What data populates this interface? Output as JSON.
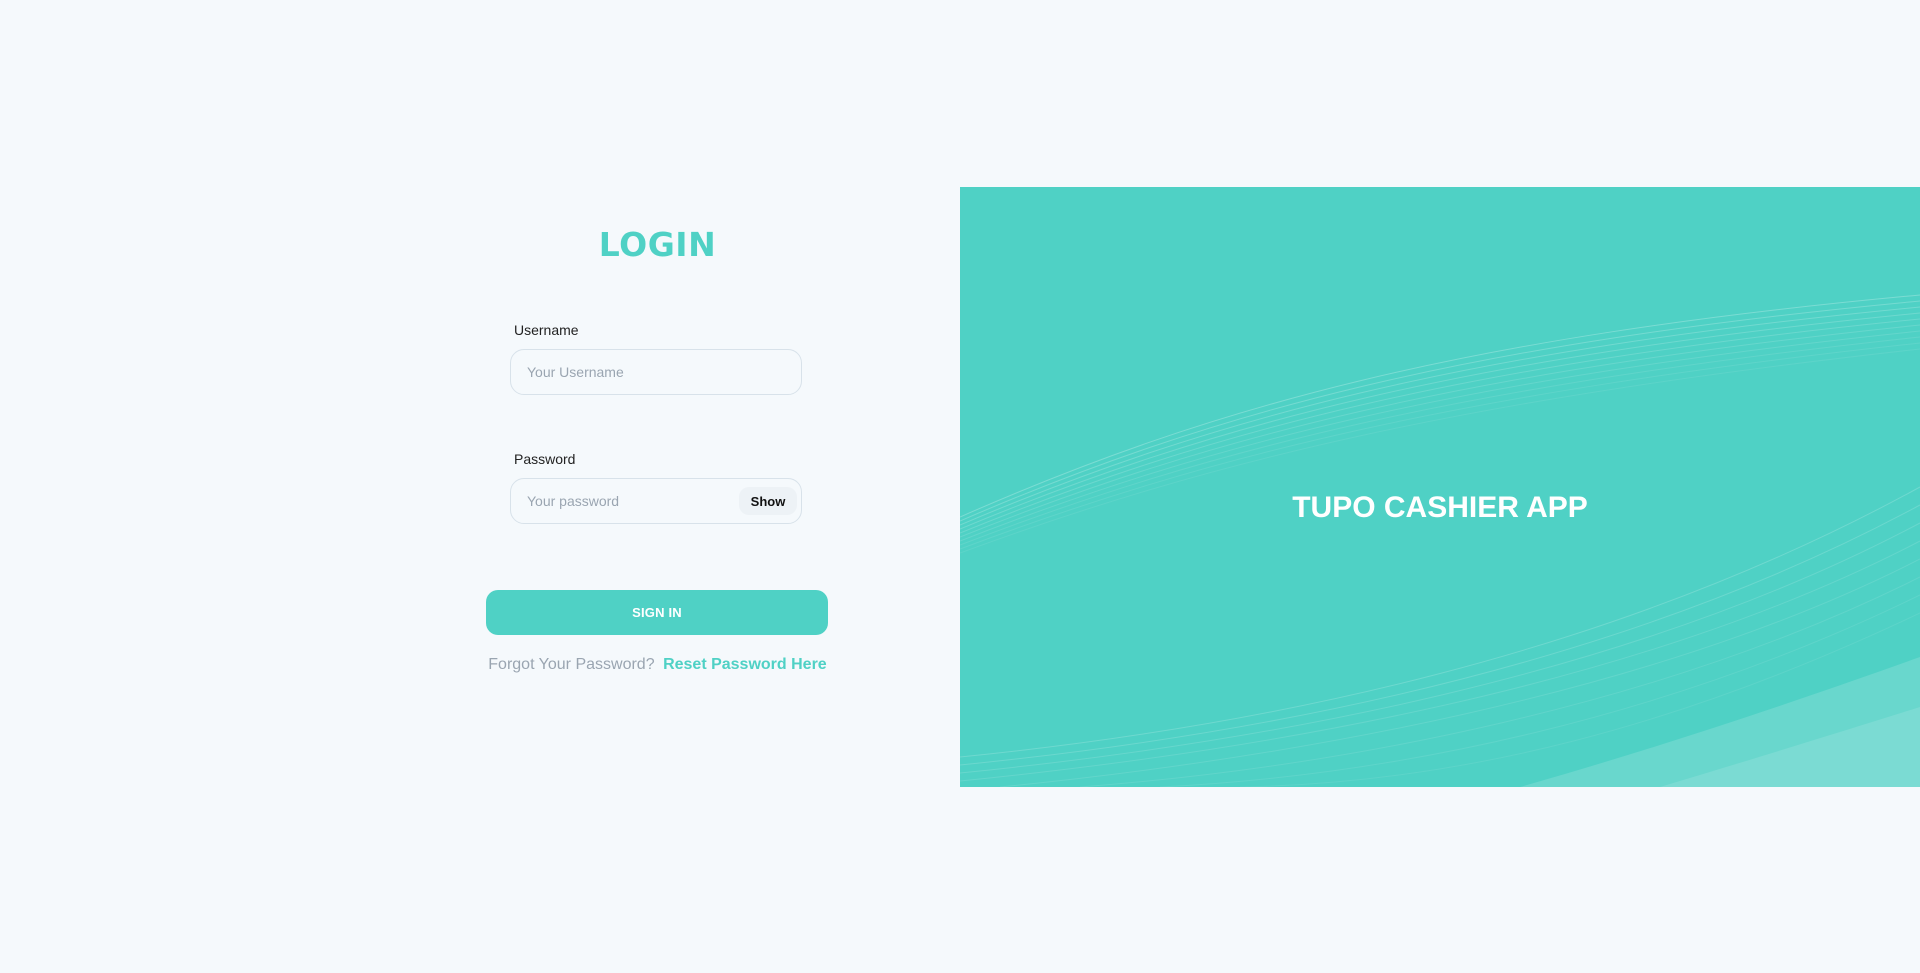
{
  "login": {
    "title": "LOGIN",
    "username": {
      "label": "Username",
      "placeholder": "Your Username",
      "value": ""
    },
    "password": {
      "label": "Password",
      "placeholder": "Your password",
      "value": "",
      "toggle_label": "Show"
    },
    "submit_label": "SIGN IN",
    "forgot_text": "Forgot Your Password?",
    "reset_link_label": "Reset Password Here"
  },
  "hero": {
    "title": "TUPO CASHIER APP"
  },
  "colors": {
    "accent": "#4fd1c5",
    "background": "#f5f9fc",
    "muted_text": "#9aa5b1",
    "white": "#ffffff"
  }
}
